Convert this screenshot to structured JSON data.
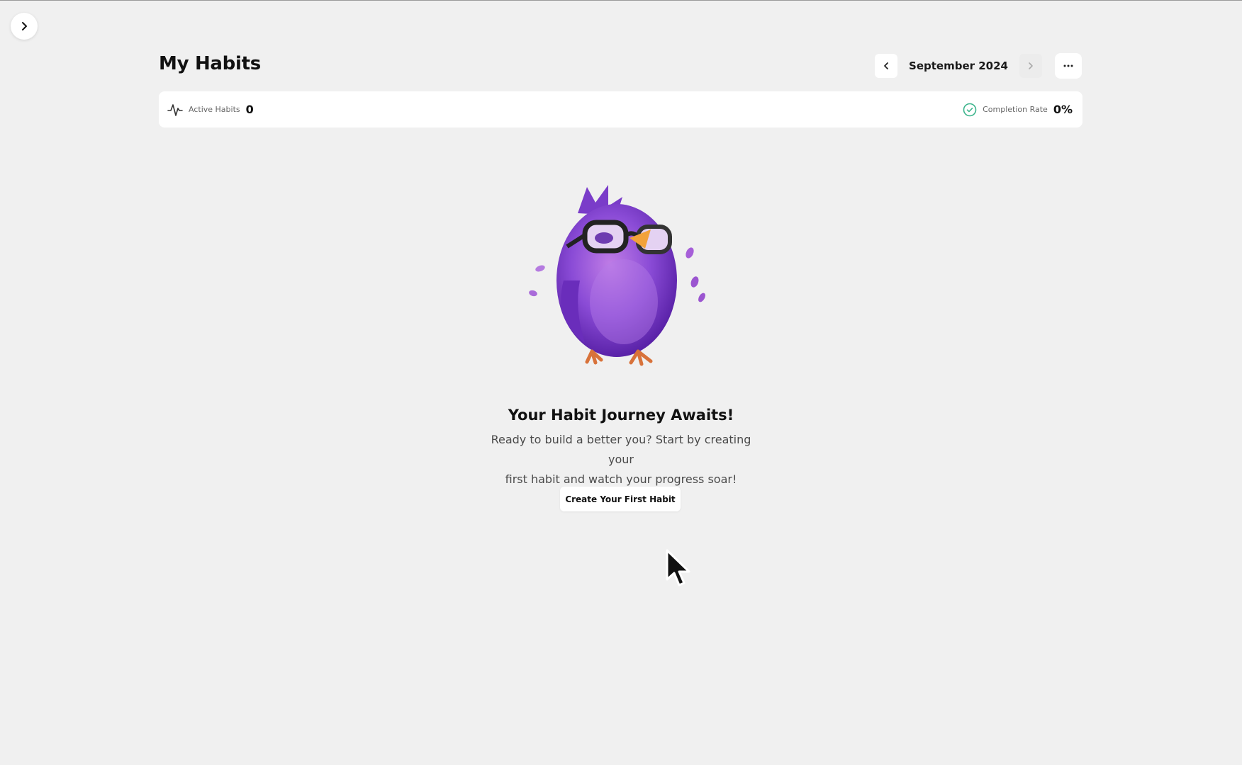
{
  "header": {
    "title": "My Habits",
    "month": "September 2024"
  },
  "stats": {
    "active_label": "Active Habits",
    "active_value": "0",
    "completion_label": "Completion Rate",
    "completion_value": "0%"
  },
  "empty_state": {
    "title": "Your Habit Journey Awaits!",
    "line1": "Ready to build a better you? Start by creating your",
    "line2": "first habit and watch your progress soar!",
    "button_label": "Create Your First Habit"
  },
  "icons": {
    "sidebar_toggle": "chevron-right-icon",
    "prev_month": "chevron-left-icon",
    "next_month": "chevron-right-icon",
    "more": "ellipsis-icon",
    "active": "activity-pulse-icon",
    "completion": "check-circle-icon",
    "mascot": "purple-bird-glasses-illustration"
  },
  "colors": {
    "background": "#f0f0f0",
    "card": "#ffffff",
    "completion_accent": "#3cb48c",
    "mascot_purple": "#7b3fd1"
  }
}
